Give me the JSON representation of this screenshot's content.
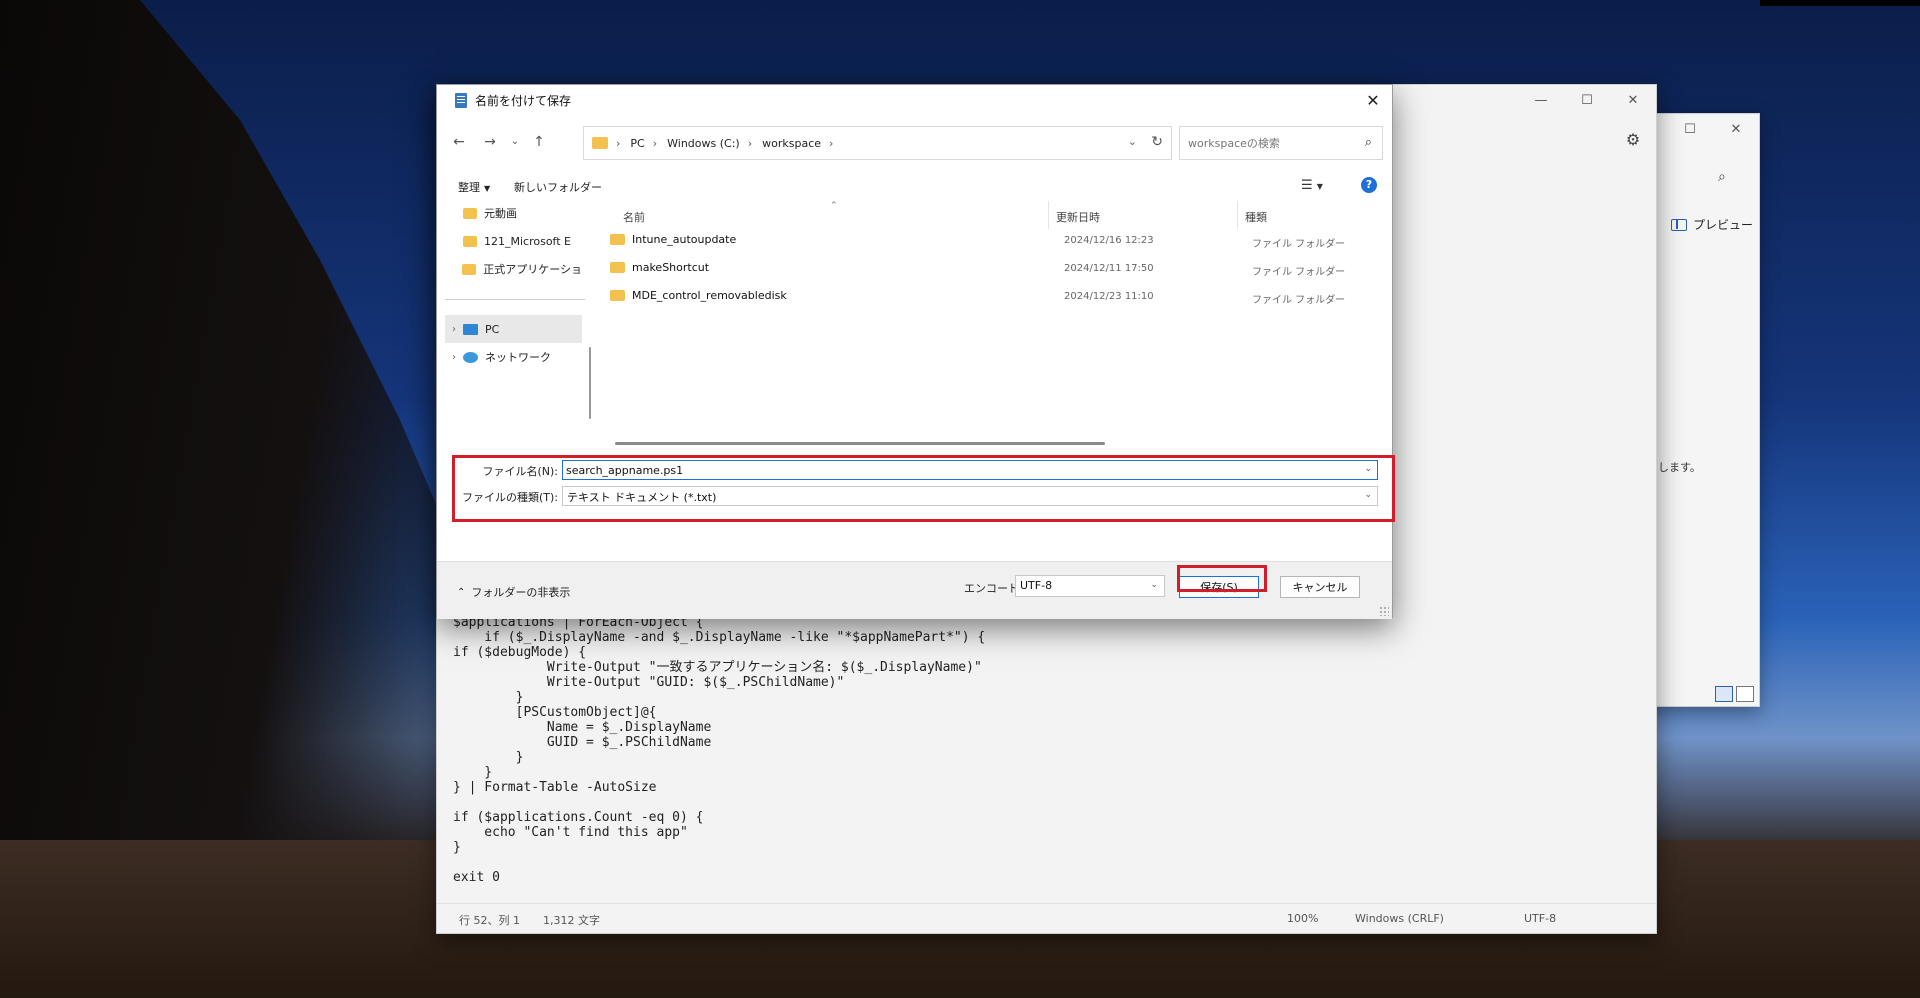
{
  "notepad": {
    "code_lines": [
      "$applications | ForEach-Object {",
      "    if ($_.DisplayName -and $_.DisplayName -like \"*$appNamePart*\") {",
      "if ($debugMode) {",
      "            Write-Output \"一致するアプリケーション名: $($_.DisplayName)\"",
      "            Write-Output \"GUID: $($_.PSChildName)\"",
      "        }",
      "        [PSCustomObject]@{",
      "            Name = $_.DisplayName",
      "            GUID = $_.PSChildName",
      "        }",
      "    }",
      "} | Format-Table -AutoSize",
      "",
      "if ($applications.Count -eq 0) {",
      "    echo \"Can't find this app\"",
      "}",
      "",
      "exit 0"
    ],
    "status": {
      "position": "行 52、列 1",
      "chars": "1,312 文字",
      "zoom": "100%",
      "line_ending": "Windows (CRLF)",
      "encoding": "UTF-8"
    }
  },
  "explorer": {
    "preview_label": "プレビュー",
    "partial_text": "します。"
  },
  "dialog": {
    "title": "名前を付けて保存",
    "breadcrumb": [
      "PC",
      "Windows (C:)",
      "workspace"
    ],
    "search_placeholder": "workspaceの検索",
    "toolbar": {
      "organize": "整理",
      "new_folder": "新しいフォルダー"
    },
    "nav_items": [
      {
        "label": "元動画",
        "type": "folder"
      },
      {
        "label": "121_Microsoft E",
        "type": "folder"
      },
      {
        "label": "正式アプリケーショ",
        "type": "folder"
      },
      {
        "label": "PC",
        "type": "pc"
      },
      {
        "label": "ネットワーク",
        "type": "network"
      }
    ],
    "columns": {
      "name": "名前",
      "modified": "更新日時",
      "type": "種類"
    },
    "files": [
      {
        "name": "Intune_autoupdate",
        "modified": "2024/12/16 12:23",
        "type": "ファイル フォルダー"
      },
      {
        "name": "makeShortcut",
        "modified": "2024/12/11 17:50",
        "type": "ファイル フォルダー"
      },
      {
        "name": "MDE_control_removabledisk",
        "modified": "2024/12/23 11:10",
        "type": "ファイル フォルダー"
      }
    ],
    "filename_label": "ファイル名(N):",
    "filename_value": "search_appname.ps1",
    "filetype_label": "ファイルの種類(T):",
    "filetype_value": "テキスト ドキュメント (*.txt)",
    "hide_folders": "フォルダーの非表示",
    "encoding_label": "エンコード:",
    "encoding_value": "UTF-8",
    "save_button": "保存(S)",
    "cancel_button": "キャンセル"
  },
  "colors": {
    "highlight_red": "#d01f2a",
    "accent_blue": "#1e6fd9",
    "folder_yellow": "#f2c14e"
  }
}
